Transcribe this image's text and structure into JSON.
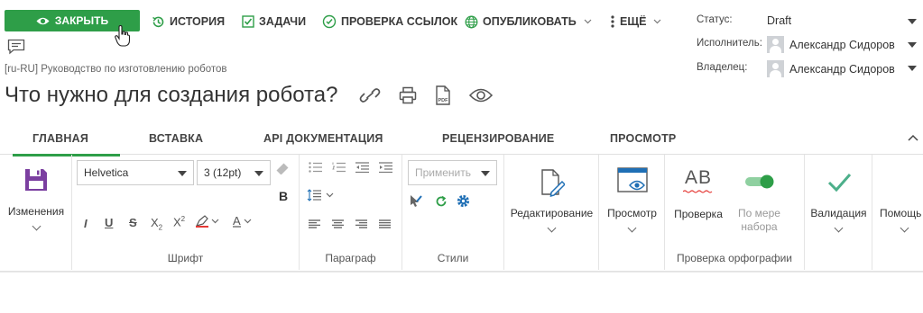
{
  "toolbar": {
    "close_label": "ЗАКРЫТЬ",
    "history_label": "ИСТОРИЯ",
    "tasks_label": "ЗАДАЧИ",
    "links_label": "ПРОВЕРКА ССЫЛОК",
    "publish_label": "ОПУБЛИКОВАТЬ",
    "more_label": "ЕЩЁ"
  },
  "meta": {
    "status_label": "Статус:",
    "status_value": "Draft",
    "assignee_label": "Исполнитель:",
    "assignee_value": "Александр Сидоров",
    "owner_label": "Владелец:",
    "owner_value": "Александр Сидоров"
  },
  "document": {
    "breadcrumb": "[ru-RU] Руководство по изготовлению роботов",
    "title": "Что нужно для создания робота?"
  },
  "tabs": [
    "ГЛАВНАЯ",
    "ВСТАВКА",
    "API ДОКУМЕНТАЦИЯ",
    "РЕЦЕНЗИРОВАНИЕ",
    "ПРОСМОТР"
  ],
  "ribbon": {
    "changes_label": "Изменения",
    "font_group_label": "Шрифт",
    "font_family": "Helvetica",
    "font_size": "3 (12pt)",
    "paragraph_group_label": "Параграф",
    "styles_group_label": "Стили",
    "apply_placeholder": "Применить",
    "edit_label": "Редактирование",
    "preview_label": "Просмотр",
    "spell_ab": "AB",
    "spell_check_label": "Проверка",
    "as_you_type_line1": "По мере",
    "as_you_type_line2": "набора",
    "spell_group_label": "Проверка орфографии",
    "validation_label": "Валидация",
    "help_label": "Помощь"
  },
  "colors": {
    "accent": "#2e9e48",
    "save_icon": "#7b3fa0",
    "validation_check": "#4caf8a",
    "link_blue": "#1f6fb5"
  }
}
